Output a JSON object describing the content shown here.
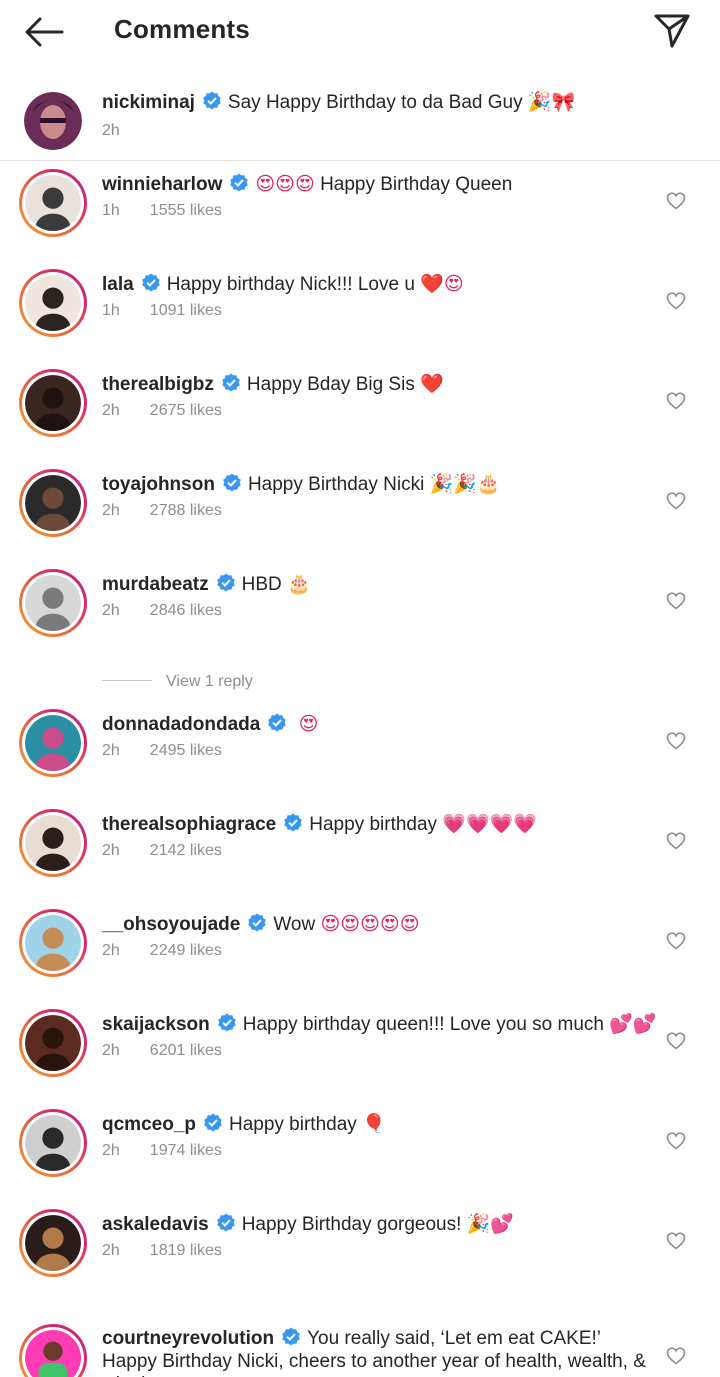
{
  "header": {
    "title": "Comments"
  },
  "caption": {
    "username": "nickiminaj",
    "text": "Say Happy Birthday to da Bad Guy",
    "emoji": "🎉🎀",
    "time": "2h"
  },
  "comments": [
    {
      "username": "winnieharlow",
      "prefix": "😍😍😍",
      "text": "Happy Birthday Queen",
      "emoji": "",
      "time": "1h",
      "likes": "1555 likes"
    },
    {
      "username": "lala",
      "prefix": "",
      "text": "Happy birthday Nick!!! Love u",
      "emoji": "❤️😍",
      "time": "1h",
      "likes": "1091 likes"
    },
    {
      "username": "therealbigbz",
      "prefix": "",
      "text": "Happy Bday Big Sis",
      "emoji": "❤️",
      "time": "2h",
      "likes": "2675 likes"
    },
    {
      "username": "toyajohnson",
      "prefix": "",
      "text": "Happy Birthday Nicki",
      "emoji": "🎉🎉🎂",
      "time": "2h",
      "likes": "2788 likes"
    },
    {
      "username": "murdabeatz",
      "prefix": "",
      "text": "HBD",
      "emoji": "🎂",
      "time": "2h",
      "likes": "2846 likes"
    },
    {
      "username": "donnadadondada",
      "prefix": "",
      "text": "",
      "emoji": "😍",
      "time": "2h",
      "likes": "2495 likes"
    },
    {
      "username": "therealsophiagrace",
      "prefix": "",
      "text": "Happy birthday",
      "emoji": "💗💗💗💗",
      "time": "2h",
      "likes": "2142 likes"
    },
    {
      "username": "__ohsoyoujade",
      "prefix": "",
      "text": "Wow",
      "emoji": "😍😍😍😍😍",
      "time": "2h",
      "likes": "2249 likes"
    },
    {
      "username": "skaijackson",
      "prefix": "",
      "text": "Happy birthday queen!!! Love you so much",
      "emoji": "💕💕",
      "time": "2h",
      "likes": "6201 likes"
    },
    {
      "username": "qcmceo_p",
      "prefix": "",
      "text": "Happy birthday",
      "emoji": "🎈",
      "time": "2h",
      "likes": "1974 likes"
    },
    {
      "username": "askaledavis",
      "prefix": "",
      "text": "Happy Birthday gorgeous!",
      "emoji": "🎉💕",
      "time": "2h",
      "likes": "1819 likes"
    }
  ],
  "view_replies": "View 1 reply",
  "last_comment": {
    "username": "courtneyrevolution",
    "text": "You really said, ‘Let em eat CAKE!’ Happy Birthday Nicki, cheers to another year of health, wealth, & winning"
  },
  "colors": {
    "verified": "#3897f0",
    "muted": "#8e8e8e",
    "text": "#262626"
  }
}
